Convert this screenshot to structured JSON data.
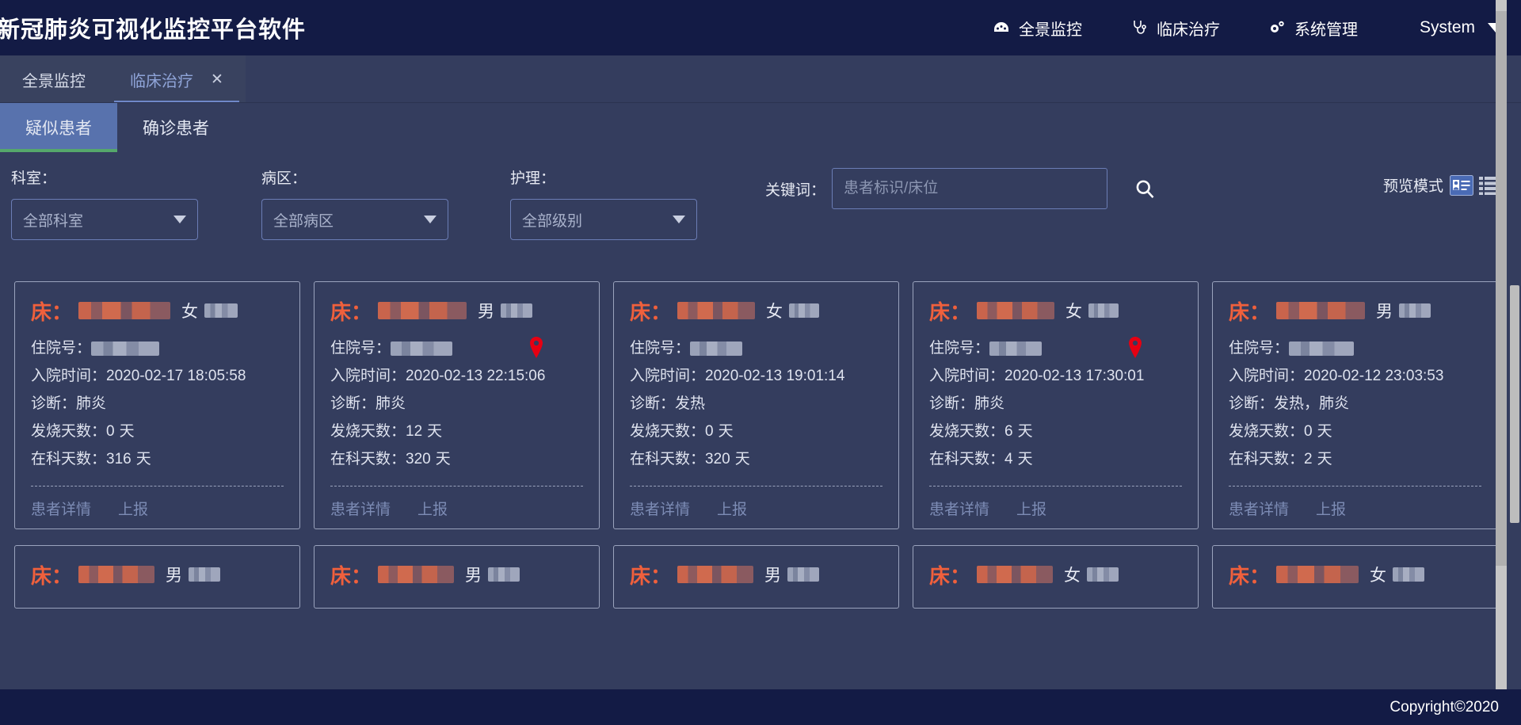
{
  "header": {
    "title": "新冠肺炎可视化监控平台软件",
    "nav": [
      {
        "label": "全景监控",
        "icon": "dashboard-icon"
      },
      {
        "label": "临床治疗",
        "icon": "stethoscope-icon"
      },
      {
        "label": "系统管理",
        "icon": "gears-icon"
      }
    ],
    "user": {
      "label": "System",
      "icon": "chevron-down-icon"
    }
  },
  "tabs": [
    {
      "label": "全景监控",
      "active": false,
      "closable": false
    },
    {
      "label": "临床治疗",
      "active": true,
      "closable": true,
      "close_glyph": "✕"
    }
  ],
  "subtabs": [
    {
      "label": "疑似患者",
      "active": true
    },
    {
      "label": "确诊患者",
      "active": false
    }
  ],
  "filters": {
    "department": {
      "label": "科室：",
      "value": "全部科室"
    },
    "ward": {
      "label": "病区：",
      "value": "全部病区"
    },
    "nursing": {
      "label": "护理：",
      "value": "全部级别"
    },
    "keyword": {
      "label": "关键词：",
      "value": "",
      "placeholder": "患者标识/床位"
    },
    "search_icon": "search-icon",
    "preview": {
      "label": "预览模式",
      "card_icon": "card-view-icon",
      "list_icon": "list-view-icon",
      "active": "card"
    }
  },
  "card_labels": {
    "bed": "床：",
    "admission_no": "住院号：",
    "admit_time": "入院时间：",
    "diagnosis": "诊断：",
    "fever_days": "发烧天数：",
    "dept_days": "在科天数：",
    "day_unit": "天",
    "detail": "患者详情",
    "report": "上报"
  },
  "cards": [
    {
      "bed": "",
      "gender": "女",
      "age": "",
      "admission_no": "",
      "admit_time": "2020-02-17 18:05:58",
      "diagnosis": "肺炎",
      "fever_days": "0",
      "dept_days": "316",
      "pin": false
    },
    {
      "bed": "",
      "gender": "男",
      "age": "",
      "admission_no": "",
      "admit_time": "2020-02-13 22:15:06",
      "diagnosis": "肺炎",
      "fever_days": "12",
      "dept_days": "320",
      "pin": true
    },
    {
      "bed": "",
      "gender": "女",
      "age": "",
      "admission_no": "",
      "admit_time": "2020-02-13 19:01:14",
      "diagnosis": "发热",
      "fever_days": "0",
      "dept_days": "320",
      "pin": false
    },
    {
      "bed": "",
      "gender": "女",
      "age": "",
      "admission_no": "",
      "admit_time": "2020-02-13 17:30:01",
      "diagnosis": "肺炎",
      "fever_days": "6",
      "dept_days": "4",
      "pin": true
    },
    {
      "bed": "",
      "gender": "男",
      "age": "",
      "admission_no": "",
      "admit_time": "2020-02-12 23:03:53",
      "diagnosis": "发热，肺炎",
      "fever_days": "0",
      "dept_days": "2",
      "pin": false
    }
  ],
  "cards_row2": [
    {
      "gender": "男"
    },
    {
      "gender": "男"
    },
    {
      "gender": "男"
    },
    {
      "gender": "女"
    },
    {
      "gender": "女"
    }
  ],
  "footer": {
    "copyright": "Copyright©2020"
  },
  "colors": {
    "header_bg": "#131b45",
    "body_bg": "#343d5e",
    "accent_bed": "#f0603c",
    "active_subtab": "#5872ad",
    "active_underline": "#55a86b",
    "pin": "#e60012",
    "link": "#7d8cb5"
  }
}
